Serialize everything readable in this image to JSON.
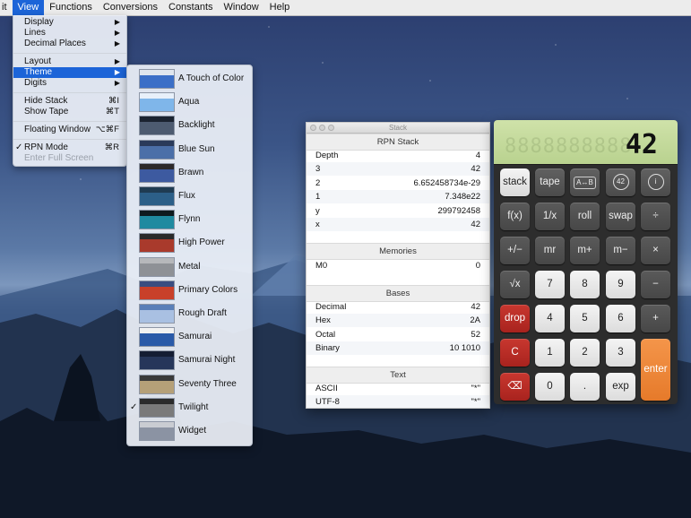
{
  "menubar": {
    "items": [
      "it",
      "View",
      "Functions",
      "Conversions",
      "Constants",
      "Window",
      "Help"
    ]
  },
  "view_menu": {
    "items": [
      {
        "label": "Display",
        "shortcut": "▶"
      },
      {
        "label": "Lines",
        "shortcut": "▶"
      },
      {
        "label": "Decimal Places",
        "shortcut": "▶"
      },
      {
        "label": "Layout",
        "shortcut": "▶"
      },
      {
        "label": "Theme",
        "shortcut": "▶"
      },
      {
        "label": "Digits",
        "shortcut": "▶"
      },
      {
        "label": "Hide Stack",
        "shortcut": "⌘I"
      },
      {
        "label": "Show Tape",
        "shortcut": "⌘T"
      },
      {
        "label": "Floating Window",
        "shortcut": "⌥⌘F"
      },
      {
        "label": "RPN Mode",
        "shortcut": "⌘R",
        "check": "✓"
      },
      {
        "label": "Enter Full Screen",
        "shortcut": ""
      }
    ]
  },
  "theme_menu": {
    "checkmark": "✓",
    "items": [
      {
        "label": "A Touch of Color",
        "colors": [
          "#dfe6ee",
          "#3b6fc7"
        ]
      },
      {
        "label": "Aqua",
        "colors": [
          "#e8f0fa",
          "#7fb6ea"
        ]
      },
      {
        "label": "Backlight",
        "colors": [
          "#1b2330",
          "#4d5b70"
        ]
      },
      {
        "label": "Blue Sun",
        "colors": [
          "#2a3a5a",
          "#4b6fa8"
        ]
      },
      {
        "label": "Brawn",
        "colors": [
          "#2d2a2a",
          "#3d5aa0"
        ]
      },
      {
        "label": "Flux",
        "colors": [
          "#1f3b52",
          "#2c5f88"
        ]
      },
      {
        "label": "Flynn",
        "colors": [
          "#0e1a1e",
          "#1f8aa0"
        ]
      },
      {
        "label": "High Power",
        "colors": [
          "#2a2a2a",
          "#a93a2c"
        ]
      },
      {
        "label": "Metal",
        "colors": [
          "#b6b8bb",
          "#8e9196"
        ]
      },
      {
        "label": "Primary Colors",
        "colors": [
          "#3a4d80",
          "#c8402a"
        ]
      },
      {
        "label": "Rough Draft",
        "colors": [
          "#5a7fb8",
          "#a9c0e2"
        ]
      },
      {
        "label": "Samurai",
        "colors": [
          "#f1f1f1",
          "#2a5aa8"
        ]
      },
      {
        "label": "Samurai Night",
        "colors": [
          "#141d33",
          "#26365a"
        ]
      },
      {
        "label": "Seventy Three",
        "colors": [
          "#3a3a3a",
          "#b5a078"
        ]
      },
      {
        "label": "Twilight",
        "colors": [
          "#2b2b2b",
          "#7a7a7a"
        ],
        "checked": true
      },
      {
        "label": "Widget",
        "colors": [
          "#c9ccd2",
          "#8b93a3"
        ]
      }
    ]
  },
  "stack_window": {
    "title": "Stack",
    "sections": {
      "rpn": "RPN Stack",
      "memories": "Memories",
      "bases": "Bases",
      "text": "Text"
    },
    "rpn_rows": [
      {
        "k": "Depth",
        "v": "4"
      },
      {
        "k": "3",
        "v": "42"
      },
      {
        "k": "2",
        "v": "6.652458734e-29"
      },
      {
        "k": "1",
        "v": "7.348e22"
      },
      {
        "k": "y",
        "v": "299792458"
      },
      {
        "k": "x",
        "v": "42"
      }
    ],
    "memory_rows": [
      {
        "k": "M0",
        "v": "0"
      }
    ],
    "base_rows": [
      {
        "k": "Decimal",
        "v": "42"
      },
      {
        "k": "Hex",
        "v": "2A"
      },
      {
        "k": "Octal",
        "v": "52"
      },
      {
        "k": "Binary",
        "v": "10 1010"
      }
    ],
    "text_rows": [
      {
        "k": "ASCII",
        "v": "\"*\""
      },
      {
        "k": "UTF-8",
        "v": "\"*\""
      }
    ]
  },
  "calculator": {
    "display": "42",
    "ghost": "8888888888",
    "rows": [
      [
        "stack",
        "tape",
        "A↔B",
        "42",
        "i"
      ],
      [
        "f(x)",
        "1/x",
        "roll",
        "swap",
        "÷"
      ],
      [
        "+/−",
        "mr",
        "m+",
        "m−",
        "×"
      ],
      [
        "√x",
        "7",
        "8",
        "9",
        "−"
      ],
      [
        "drop",
        "4",
        "5",
        "6",
        "+"
      ],
      [
        "C",
        "1",
        "2",
        "3",
        "enter"
      ],
      [
        "⌫",
        "0",
        ".",
        "exp",
        ""
      ]
    ]
  }
}
